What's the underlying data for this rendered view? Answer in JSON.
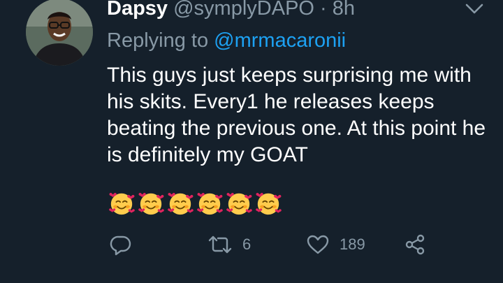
{
  "tweet": {
    "display_name": "Dapsy",
    "handle": "@symplyDAPO",
    "separator": "·",
    "time": "8h",
    "replying_prefix": "Replying to",
    "replying_to": "@mrmacaronii",
    "text": "This guys just keeps surprising me with his skits. Every1 he releases keeps beating the previous one. At this point he is definitely my GOAT",
    "emoji_name": "smiling-face-with-hearts",
    "emoji_count": 6
  },
  "actions": {
    "reply_icon": "reply-icon",
    "retweet_icon": "retweet-icon",
    "retweet_count": "6",
    "like_icon": "like-icon",
    "like_count": "189",
    "share_icon": "share-icon"
  },
  "colors": {
    "background": "#15202b",
    "text": "#ffffff",
    "secondary": "#8899a6",
    "link": "#1da1f2"
  }
}
